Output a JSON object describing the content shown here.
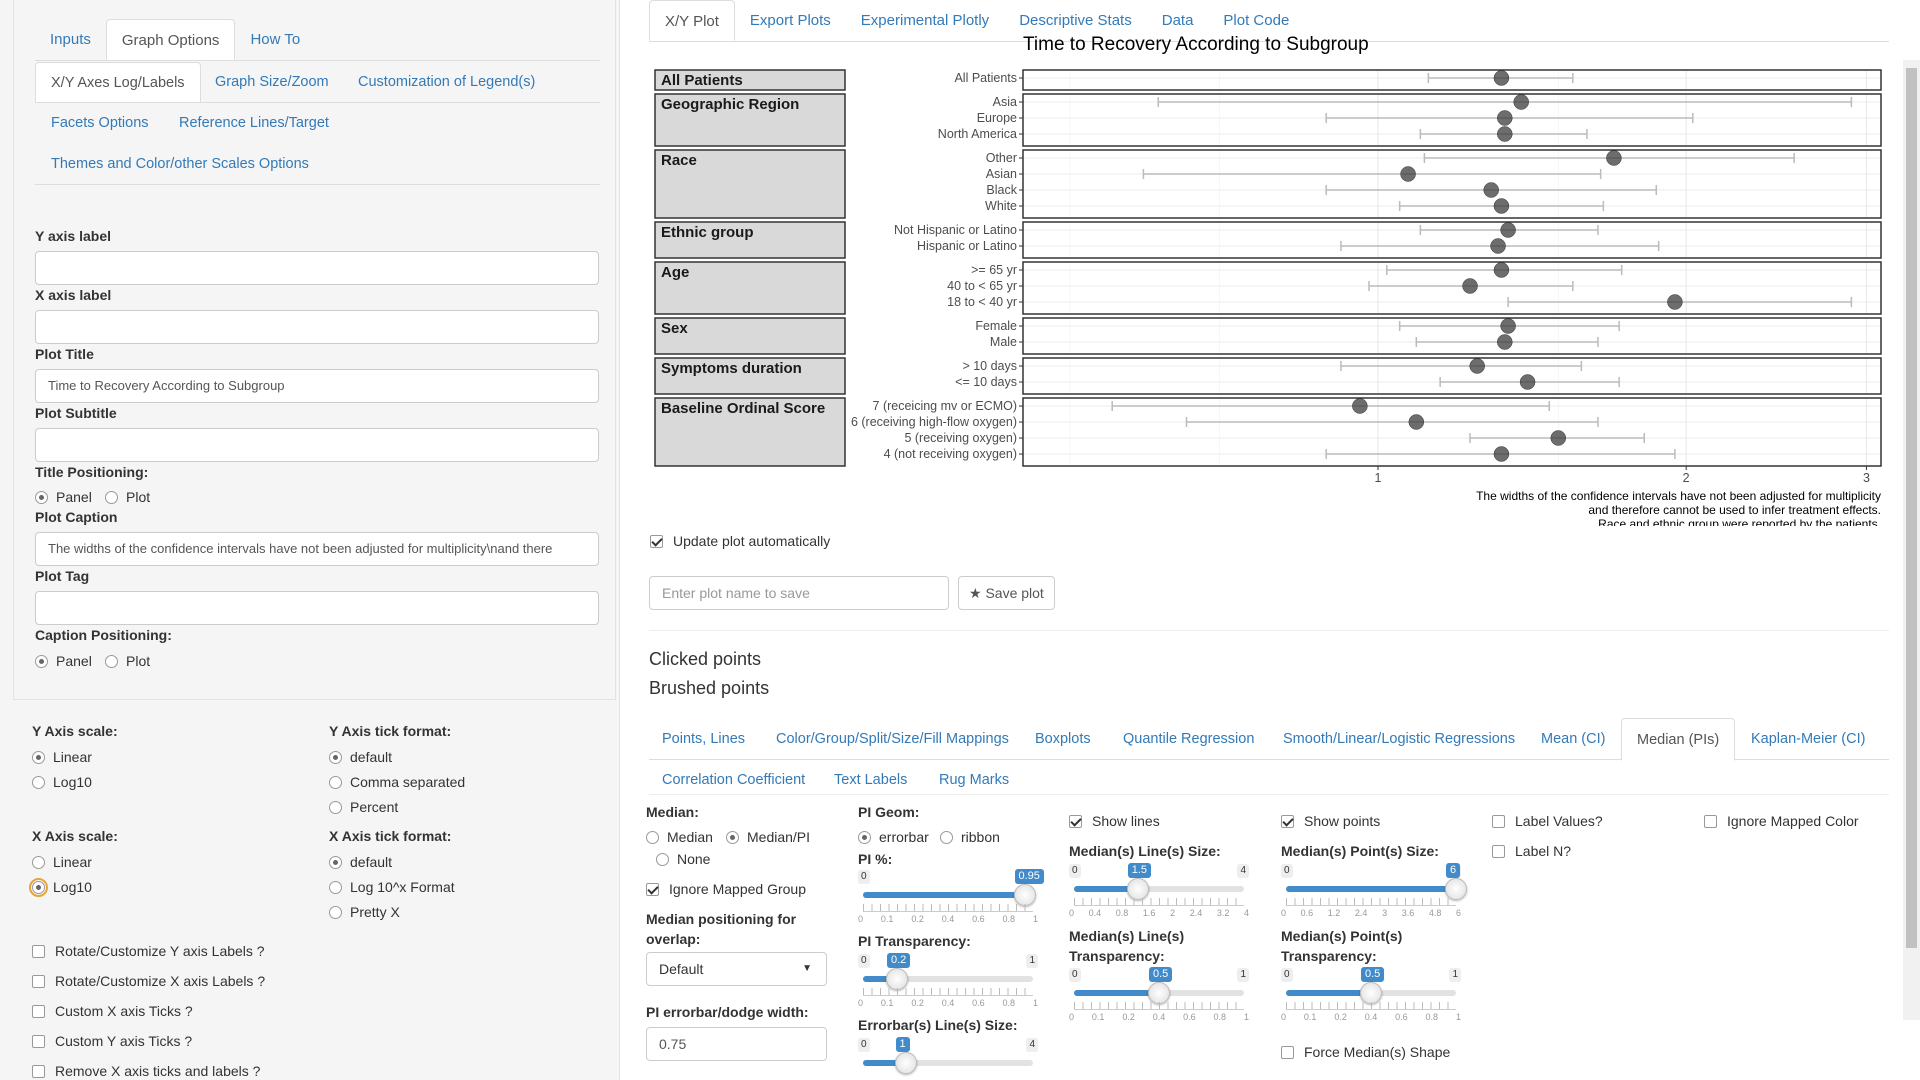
{
  "left": {
    "top_tabs": [
      "Inputs",
      "Graph Options",
      "How To"
    ],
    "sub_tabs": [
      "X/Y Axes Log/Labels",
      "Graph Size/Zoom",
      "Customization of Legend(s)",
      "Facets Options",
      "Reference Lines/Target",
      "Themes and Color/other Scales Options"
    ],
    "y_axis_label": {
      "label": "Y axis label",
      "value": ""
    },
    "x_axis_label": {
      "label": "X axis label",
      "value": ""
    },
    "plot_title": {
      "label": "Plot Title",
      "value": "Time to Recovery According to Subgroup"
    },
    "plot_subtitle": {
      "label": "Plot Subtitle",
      "value": ""
    },
    "title_positioning": {
      "label": "Title Positioning:",
      "options": [
        "Panel",
        "Plot"
      ],
      "selected": "Panel"
    },
    "plot_caption": {
      "label": "Plot Caption",
      "value": "The widths of the confidence intervals have not been adjusted for multiplicity\\nand there"
    },
    "plot_tag": {
      "label": "Plot Tag",
      "value": ""
    },
    "caption_positioning": {
      "label": "Caption Positioning:",
      "options": [
        "Panel",
        "Plot"
      ],
      "selected": "Panel"
    },
    "y_axis_scale": {
      "label": "Y Axis scale:",
      "options": [
        "Linear",
        "Log10"
      ],
      "selected": "Linear"
    },
    "y_tick_format": {
      "label": "Y Axis tick format:",
      "options": [
        "default",
        "Comma separated",
        "Percent"
      ],
      "selected": "default"
    },
    "x_axis_scale": {
      "label": "X Axis scale:",
      "options": [
        "Linear",
        "Log10"
      ],
      "selected": "Log10"
    },
    "x_tick_format": {
      "label": "X Axis tick format:",
      "options": [
        "default",
        "Log 10^x Format",
        "Pretty X"
      ],
      "selected": "default"
    },
    "checkboxes": [
      "Rotate/Customize Y axis Labels ?",
      "Rotate/Customize X axis Labels ?",
      "Custom X axis Ticks ?",
      "Custom Y axis Ticks ?",
      "Remove X axis ticks and labels ?"
    ]
  },
  "right": {
    "main_tabs": [
      "X/Y Plot",
      "Export Plots",
      "Experimental Plotly",
      "Descriptive Stats",
      "Data",
      "Plot Code"
    ],
    "update_auto": "Update plot automatically",
    "plot_name_placeholder": "Enter plot name to save",
    "save_plot": "Save plot",
    "clicked_points": "Clicked points",
    "brushed_points": "Brushed points",
    "option_tabs_row1": [
      "Points, Lines",
      "Color/Group/Split/Size/Fill Mappings",
      "Boxplots",
      "Quantile Regression",
      "Smooth/Linear/Logistic Regressions",
      "Mean (CI)",
      "Median (PIs)",
      "Kaplan-Meier (CI)"
    ],
    "option_tabs_row2": [
      "Correlation Coefficient",
      "Text Labels",
      "Rug Marks"
    ],
    "median": {
      "label": "Median:",
      "options": [
        "Median",
        "Median/PI",
        "None"
      ],
      "selected": "Median/PI",
      "ignore_group": "Ignore Mapped Group",
      "positioning_label": "Median positioning for overlap:",
      "positioning_value": "Default",
      "dodge_label": "PI errorbar/dodge width:",
      "dodge_value": "0.75"
    },
    "pi": {
      "geom_label": "PI Geom:",
      "geom_options": [
        "errorbar",
        "ribbon"
      ],
      "geom_selected": "errorbar",
      "pct_label": "PI %:",
      "pct": {
        "min": "0",
        "max": "1",
        "value": "0.95",
        "frac": 0.95,
        "ticks": [
          "0",
          "0.1",
          "0.2",
          "0.4",
          "0.6",
          "0.8",
          "1"
        ]
      },
      "transp_label": "PI Transparency:",
      "transp": {
        "min": "0",
        "max": "1",
        "value": "0.2",
        "frac": 0.2,
        "ticks": [
          "0",
          "0.1",
          "0.2",
          "0.4",
          "0.6",
          "0.8",
          "1"
        ]
      },
      "eb_size_label": "Errorbar(s) Line(s) Size:",
      "eb_size": {
        "min": "0",
        "max": "4",
        "value": "1",
        "frac": 0.25
      }
    },
    "lines": {
      "show": "Show lines",
      "size_label": "Median(s) Line(s) Size:",
      "size": {
        "min": "0",
        "max": "4",
        "value": "1.5",
        "frac": 0.375,
        "ticks": [
          "0",
          "0.4",
          "0.8",
          "1.6",
          "2",
          "2.4",
          "3.2",
          "4"
        ]
      },
      "transp_label": "Median(s) Line(s) Transparency:",
      "transp": {
        "min": "0",
        "max": "1",
        "value": "0.5",
        "frac": 0.5,
        "ticks": [
          "0",
          "0.1",
          "0.2",
          "0.4",
          "0.6",
          "0.8",
          "1"
        ]
      }
    },
    "points": {
      "show": "Show points",
      "size_label": "Median(s) Point(s) Size:",
      "size": {
        "min": "0",
        "max": "6",
        "value": "6",
        "frac": 1.0,
        "ticks": [
          "0",
          "0.6",
          "1.2",
          "2.4",
          "3",
          "3.6",
          "4.8",
          "6"
        ]
      },
      "transp_label": "Median(s) Point(s) Transparency:",
      "transp": {
        "min": "0",
        "max": "1",
        "value": "0.5",
        "frac": 0.5,
        "ticks": [
          "0",
          "0.1",
          "0.2",
          "0.4",
          "0.6",
          "0.8",
          "1"
        ]
      },
      "force_shape": "Force Median(s) Shape"
    },
    "label_values": "Label Values?",
    "label_n": "Label N?",
    "ignore_color": "Ignore Mapped Color"
  },
  "chart_data": {
    "type": "scatter",
    "title": "Time to Recovery According to Subgroup",
    "x_scale": "log10",
    "xlim": [
      0.45,
      3.1
    ],
    "x_ticks": [
      "1",
      "2",
      "3"
    ],
    "caption": [
      "The widths of the confidence intervals have not been adjusted for multiplicity",
      "and therefore cannot be used to infer treatment effects.",
      "Race and ethnic group were reported by the patients."
    ],
    "facets": [
      {
        "name": "All Patients",
        "rows": [
          {
            "label": "All Patients",
            "est": 1.32,
            "lo": 1.12,
            "hi": 1.55
          }
        ]
      },
      {
        "name": "Geographic Region",
        "rows": [
          {
            "label": "Asia",
            "est": 1.38,
            "lo": 0.61,
            "hi": 2.9
          },
          {
            "label": "Europe",
            "est": 1.33,
            "lo": 0.89,
            "hi": 2.03
          },
          {
            "label": "North America",
            "est": 1.33,
            "lo": 1.1,
            "hi": 1.6
          }
        ]
      },
      {
        "name": "Race",
        "rows": [
          {
            "label": "Other",
            "est": 1.7,
            "lo": 1.11,
            "hi": 2.55
          },
          {
            "label": "Asian",
            "est": 1.07,
            "lo": 0.59,
            "hi": 1.65
          },
          {
            "label": "Black",
            "est": 1.29,
            "lo": 0.89,
            "hi": 1.87
          },
          {
            "label": "White",
            "est": 1.32,
            "lo": 1.05,
            "hi": 1.66
          }
        ]
      },
      {
        "name": "Ethnic group",
        "rows": [
          {
            "label": "Not Hispanic or Latino",
            "est": 1.34,
            "lo": 1.1,
            "hi": 1.64
          },
          {
            "label": "Hispanic or Latino",
            "est": 1.31,
            "lo": 0.92,
            "hi": 1.88
          }
        ]
      },
      {
        "name": "Age",
        "rows": [
          {
            "label": ">= 65 yr",
            "est": 1.32,
            "lo": 1.02,
            "hi": 1.73
          },
          {
            "label": "40 to < 65 yr",
            "est": 1.23,
            "lo": 0.98,
            "hi": 1.55
          },
          {
            "label": "18 to < 40 yr",
            "est": 1.95,
            "lo": 1.34,
            "hi": 2.9
          }
        ]
      },
      {
        "name": "Sex",
        "rows": [
          {
            "label": "Female",
            "est": 1.34,
            "lo": 1.05,
            "hi": 1.72
          },
          {
            "label": "Male",
            "est": 1.33,
            "lo": 1.09,
            "hi": 1.64
          }
        ]
      },
      {
        "name": "Symptoms duration",
        "rows": [
          {
            "label": "> 10 days",
            "est": 1.25,
            "lo": 0.92,
            "hi": 1.58
          },
          {
            "label": "<= 10 days",
            "est": 1.4,
            "lo": 1.15,
            "hi": 1.72
          }
        ]
      },
      {
        "name": "Baseline Ordinal Score",
        "rows": [
          {
            "label": "7 (receicing mv or ECMO)",
            "est": 0.96,
            "lo": 0.55,
            "hi": 1.47
          },
          {
            "label": "6 (receiving high-flow oxygen)",
            "est": 1.09,
            "lo": 0.65,
            "hi": 1.64
          },
          {
            "label": "5 (receiving oxygen)",
            "est": 1.5,
            "lo": 1.23,
            "hi": 1.82
          },
          {
            "label": "4 (not receiving oxygen)",
            "est": 1.32,
            "lo": 0.89,
            "hi": 1.95
          }
        ]
      }
    ]
  }
}
